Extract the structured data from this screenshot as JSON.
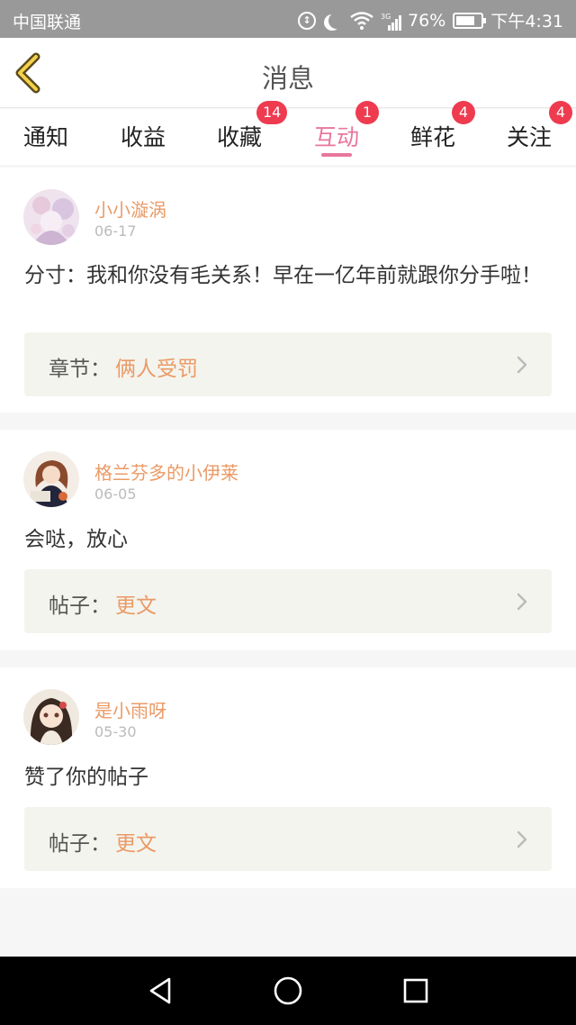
{
  "status_bar": {
    "carrier": "中国联通",
    "network_type": "3G",
    "battery_percent": "76%",
    "battery_level": 0.76,
    "time": "下午4:31",
    "icons": [
      "data-saver-icon",
      "moon-icon",
      "wifi-icon",
      "signal-icon",
      "battery-icon"
    ]
  },
  "header": {
    "title": "消息",
    "back_icon": "chevron-left-icon"
  },
  "tabs": [
    {
      "label": "通知",
      "badge": ""
    },
    {
      "label": "收益",
      "badge": ""
    },
    {
      "label": "收藏",
      "badge": "14"
    },
    {
      "label": "互动",
      "badge": "1",
      "active": true
    },
    {
      "label": "鲜花",
      "badge": "4"
    },
    {
      "label": "关注",
      "badge": "4"
    }
  ],
  "colors": {
    "accent_pink": "#e8769e",
    "username_orange": "#ea9a66",
    "badge_red": "#ee3b4f"
  },
  "messages": [
    {
      "username": "小小漩涡",
      "date": "06-17",
      "content": "分寸：我和你没有毛关系！早在一亿年前就跟你分手啦！",
      "ref_label": "章节：",
      "ref_value": "俩人受罚"
    },
    {
      "username": "格兰芬多的小伊莱",
      "date": "06-05",
      "content": "会哒，放心",
      "ref_label": "帖子：",
      "ref_value": "更文"
    },
    {
      "username": "是小雨呀",
      "date": "05-30",
      "content": "赞了你的帖子",
      "ref_label": "帖子：",
      "ref_value": "更文"
    }
  ],
  "nav_bar": {
    "icons": [
      "back-triangle-icon",
      "home-circle-icon",
      "recents-square-icon"
    ]
  }
}
